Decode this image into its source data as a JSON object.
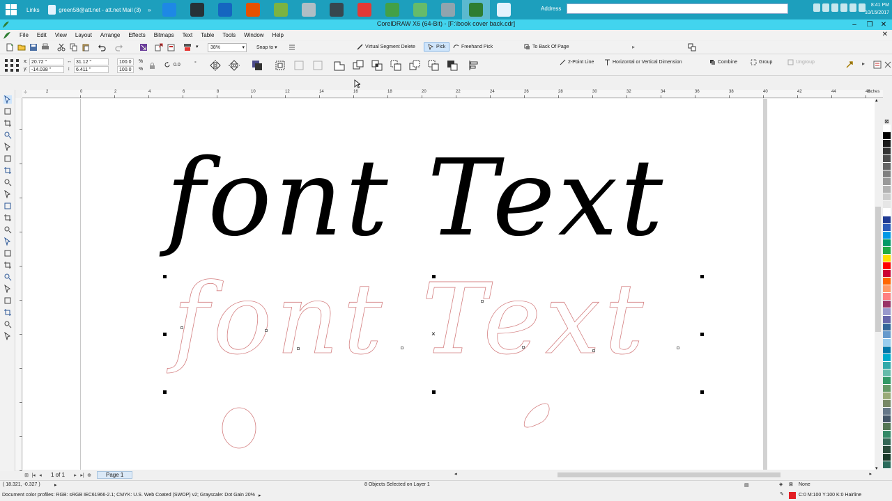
{
  "taskbar": {
    "links_label": "Links",
    "mail_label": "green58@att.net - att.net Mail (3)",
    "address_label": "Address",
    "clock_time": "8:41 PM",
    "clock_date": "10/15/2017",
    "apps": [
      {
        "name": "ie-icon",
        "color": "#1e88e5"
      },
      {
        "name": "calendar-icon",
        "color": "#263238"
      },
      {
        "name": "word-icon",
        "color": "#1565c0"
      },
      {
        "name": "app-icon",
        "color": "#e65100"
      },
      {
        "name": "pencil-icon",
        "color": "#7cb342"
      },
      {
        "name": "printer-icon",
        "color": "#b0bec5"
      },
      {
        "name": "snagit-icon",
        "color": "#37474f"
      },
      {
        "name": "chrome-icon",
        "color": "#e53935"
      },
      {
        "name": "coreldraw-icon",
        "color": "#43a047"
      },
      {
        "name": "leaf-icon",
        "color": "#66bb6a"
      },
      {
        "name": "photo-icon",
        "color": "#90a4ae"
      },
      {
        "name": "coreldraw-active-icon",
        "color": "#2e7d32"
      },
      {
        "name": "document-icon",
        "color": "#e3f2fd"
      }
    ]
  },
  "window": {
    "title": "CorelDRAW X6 (64-Bit) - [F:\\book cover back.cdr]"
  },
  "menu": [
    "File",
    "Edit",
    "View",
    "Layout",
    "Arrange",
    "Effects",
    "Bitmaps",
    "Text",
    "Table",
    "Tools",
    "Window",
    "Help"
  ],
  "toolbar": {
    "zoom_value": "38%",
    "snap_to_label": "Snap to",
    "virtual_segment_delete_label": "Virtual Segment Delete",
    "pick_label": "Pick",
    "freehand_pick_label": "Freehand Pick",
    "to_back_of_page_label": "To Back Of Page"
  },
  "propertybar": {
    "x_label": "x:",
    "x_value": "20.72 \"",
    "y_label": "y:",
    "y_value": "-14.038 \"",
    "width_value": "31.12 \"",
    "height_value": "6.411 \"",
    "scale_x": "100.0",
    "scale_y": "100.0",
    "percent": "%",
    "rotation_value": "0.0",
    "rotation_unit": "°",
    "two_point_line_label": "2-Point Line",
    "dimension_label": "Horizontal or Vertical Dimension",
    "combine_label": "Combine",
    "group_label": "Group",
    "ungroup_label": "Ungroup"
  },
  "ruler": {
    "ticks": [
      "2",
      "0",
      "2",
      "4",
      "6",
      "8",
      "10",
      "12",
      "14",
      "16",
      "18",
      "20",
      "22",
      "24",
      "26",
      "28",
      "30",
      "32",
      "34",
      "36",
      "38",
      "40",
      "42",
      "44",
      "46"
    ],
    "unit_label": "inches"
  },
  "canvas": {
    "heading_text": "font Text",
    "outline_text": "font Text"
  },
  "pagenav": {
    "page_count": "1 of 1",
    "page_tab": "Page 1"
  },
  "palette": [
    "#ffffff",
    "#000000",
    "#1a1a1a",
    "#333333",
    "#4d4d4d",
    "#666666",
    "#808080",
    "#999999",
    "#b3b3b3",
    "#cccccc",
    "#e6e6e6",
    "#ffffff",
    "#1f3a93",
    "#2e5cb8",
    "#0099e6",
    "#009966",
    "#22aa44",
    "#ffdd00",
    "#ff0000",
    "#cc0033",
    "#ff6600",
    "#ff9966",
    "#ff8080",
    "#993366",
    "#9999cc",
    "#6666aa",
    "#336699",
    "#6699cc",
    "#99ccee",
    "#0077aa",
    "#00aacc",
    "#33aaaa",
    "#66bbaa",
    "#339966",
    "#669966",
    "#99aa77",
    "#778866",
    "#667788",
    "#445566",
    "#557755",
    "#338866",
    "#336655",
    "#2a4a3a",
    "#1a3a2a",
    "#2a6a5a"
  ],
  "statusbar": {
    "cursor_position": "( 18.321, -0.327 )",
    "selection_info": "8 Objects Selected on Layer 1",
    "color_profiles": "Document color profiles: RGB: sRGB IEC61966-2.1; CMYK: U.S. Web Coated (SWOP) v2; Grayscale: Dot Gain 20%",
    "fill_label": "None",
    "outline_info": "C:0 M:100 Y:100 K:0  Hairline"
  }
}
